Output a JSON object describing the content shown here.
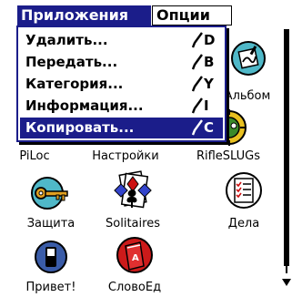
{
  "menubar": {
    "items": [
      {
        "label": "Приложения"
      },
      {
        "label": "Опции"
      }
    ]
  },
  "dropdown": {
    "items": [
      {
        "label": "Удалить...",
        "shortcut": "D"
      },
      {
        "label": "Передать...",
        "shortcut": "B"
      },
      {
        "label": "Категория...",
        "shortcut": "Y"
      },
      {
        "label": "Информация...",
        "shortcut": "I"
      },
      {
        "label": "Копировать...",
        "shortcut": "C"
      }
    ],
    "selected_index": 4
  },
  "apps": [
    {
      "label": "Альбом",
      "icon": "photo-album-icon"
    },
    {
      "label": "PiLoc",
      "icon": "piloc-icon"
    },
    {
      "label": "Настройки",
      "icon": "settings-icon"
    },
    {
      "label": "RifleSLUGs",
      "icon": "rifleslugs-icon"
    },
    {
      "label": "Защита",
      "icon": "key-icon"
    },
    {
      "label": "Solitaires",
      "icon": "cards-icon"
    },
    {
      "label": "Дела",
      "icon": "todo-list-icon"
    },
    {
      "label": "Привет!",
      "icon": "hello-icon"
    },
    {
      "label": "СловоЕд",
      "icon": "dictionary-icon"
    }
  ],
  "colors": {
    "highlight": "#1b1d8a",
    "text": "#000000",
    "background": "#ffffff"
  }
}
